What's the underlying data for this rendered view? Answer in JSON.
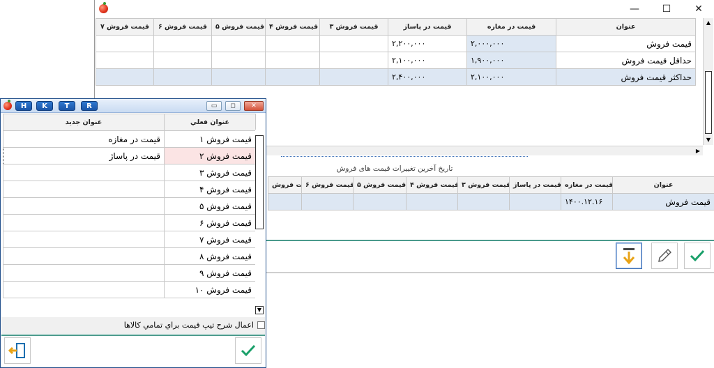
{
  "main_window": {
    "controls": {
      "minimize": "—",
      "maximize": "☐",
      "close": "✕"
    },
    "price_table": {
      "headers": [
        "عنوان",
        "قیمت در مغازه",
        "قیمت در پاساژ",
        "قیمت فروش ۳",
        "قیمت فروش ۴",
        "قیمت فروش ۵",
        "قیمت فروش ۶",
        "قیمت فروش ۷"
      ],
      "rows": [
        {
          "title": "قیمت فروش",
          "store": "۲,۰۰۰,۰۰۰",
          "mall": "۲,۲۰۰,۰۰۰"
        },
        {
          "title": "حداقل قیمت فروش",
          "store": "۱,۹۰۰,۰۰۰",
          "mall": "۲,۱۰۰,۰۰۰"
        },
        {
          "title": "حداکثر قیمت فروش",
          "store": "۲,۱۰۰,۰۰۰",
          "mall": "۲,۴۰۰,۰۰۰"
        }
      ]
    },
    "history_caption": "تاریخ آخرین تغییرات قیمت های فروش",
    "history_table": {
      "headers": [
        "عنوان",
        "قیمت در مغازه",
        "قیمت در پاساژ",
        "قیمت فروش ۳",
        "قیمت فروش ۴",
        "قیمت فروش ۵",
        "قیمت فروش ۶",
        "قیمت فروش"
      ],
      "rows": [
        {
          "title": "قیمت فروش",
          "store": "۱۴۰۰.۱۲.۱۶"
        }
      ]
    },
    "toolbar": {
      "accent": "#e8a317",
      "check_color": "#1aa06a"
    }
  },
  "dialog": {
    "hotkeys": [
      "H",
      "K",
      "T",
      "R"
    ],
    "controls": {
      "minimize": "▭",
      "restore": "◻",
      "close": "✕"
    },
    "headers": {
      "current": "عنوان فعلي",
      "new": "عنوان جديد"
    },
    "rows": [
      {
        "current": "قیمت فروش ۱",
        "new": "قیمت در مغازه"
      },
      {
        "current": "قیمت فروش ۲",
        "new": "قیمت در پاساژ"
      },
      {
        "current": "قیمت فروش ۳",
        "new": ""
      },
      {
        "current": "قیمت فروش ۴",
        "new": ""
      },
      {
        "current": "قیمت فروش ۵",
        "new": ""
      },
      {
        "current": "قیمت فروش ۶",
        "new": ""
      },
      {
        "current": "قیمت فروش ۷",
        "new": ""
      },
      {
        "current": "قیمت فروش ۸",
        "new": ""
      },
      {
        "current": "قیمت فروش ۹",
        "new": ""
      },
      {
        "current": "قیمت فروش ۱۰",
        "new": ""
      }
    ],
    "apply_all_label": "اعمال شرح تیپ قیمت براي تمامي كالاها"
  }
}
